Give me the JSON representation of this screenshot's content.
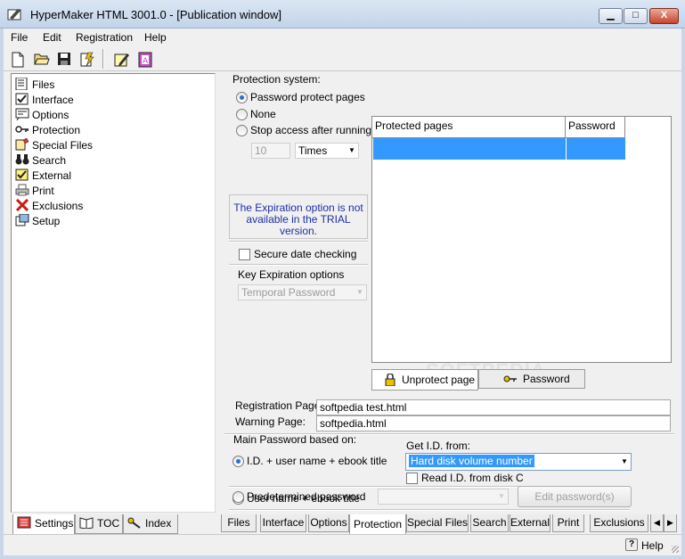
{
  "window": {
    "title": "HyperMaker HTML 3001.0 - [Publication window]",
    "controls": {
      "minimize": "▁",
      "maximize": "□",
      "close": "X"
    }
  },
  "menu": [
    "File",
    "Edit",
    "Registration",
    "Help"
  ],
  "toolbar": [
    "new-file-icon",
    "open-folder-icon",
    "save-disk-icon",
    "build-icon",
    "edit-pencil-icon",
    "publication-icon"
  ],
  "tree": {
    "items": [
      {
        "label": "Files",
        "icon": "files-icon"
      },
      {
        "label": "Interface",
        "icon": "interface-icon"
      },
      {
        "label": "Options",
        "icon": "options-icon"
      },
      {
        "label": "Protection",
        "icon": "key-icon"
      },
      {
        "label": "Special Files",
        "icon": "special-files-icon"
      },
      {
        "label": "Search",
        "icon": "binoculars-icon"
      },
      {
        "label": "External",
        "icon": "external-icon"
      },
      {
        "label": "Print",
        "icon": "printer-icon"
      },
      {
        "label": "Exclusions",
        "icon": "red-x-icon"
      },
      {
        "label": "Setup",
        "icon": "setup-icon"
      }
    ]
  },
  "left_tabs": [
    {
      "label": "Settings",
      "selected": true
    },
    {
      "label": "TOC",
      "selected": false
    },
    {
      "label": "Index",
      "selected": false
    }
  ],
  "protection": {
    "group_label": "Protection system:",
    "radio_password": "Password protect pages",
    "radio_none": "None",
    "radio_stop": "Stop access after running:",
    "times_value": "10",
    "times_unit": "Times",
    "trial_note": "The Expiration option is not available in the TRIAL version.",
    "secure_date": "Secure date checking",
    "key_expiration_label": "Key Expiration options",
    "key_expiration_value": "Temporal Password"
  },
  "table": {
    "col_pages": "Protected pages",
    "col_password": "Password",
    "selection_color": "#3399ff"
  },
  "table_buttons": {
    "unprotect": "Unprotect page",
    "password": "Password"
  },
  "pages": {
    "registration_label": "Registration Page:",
    "registration_value": "softpedia test.html",
    "warning_label": "Warning Page:",
    "warning_value": "softpedia.html"
  },
  "main_password": {
    "label": "Main Password based on:",
    "opt_id_user": "I.D. + user name + ebook title",
    "get_id_label": "Get I.D. from:",
    "get_id_value": "Hard disk volume number",
    "read_id_disk": "Read I.D. from disk C",
    "opt_user": "User name + ebook  title",
    "opt_predetermined": "Predetermined password",
    "edit_button": "Edit password(s)"
  },
  "bottom_tabs": [
    "Files",
    "Interface",
    "Options",
    "Protection",
    "Special Files",
    "Search",
    "External",
    "Print",
    "Exclusions"
  ],
  "bottom_tab_selected": "Protection",
  "scroll": {
    "left": "◀",
    "right": "▶"
  },
  "status": {
    "help": "Help"
  },
  "watermark": "SOFTPEDIA"
}
